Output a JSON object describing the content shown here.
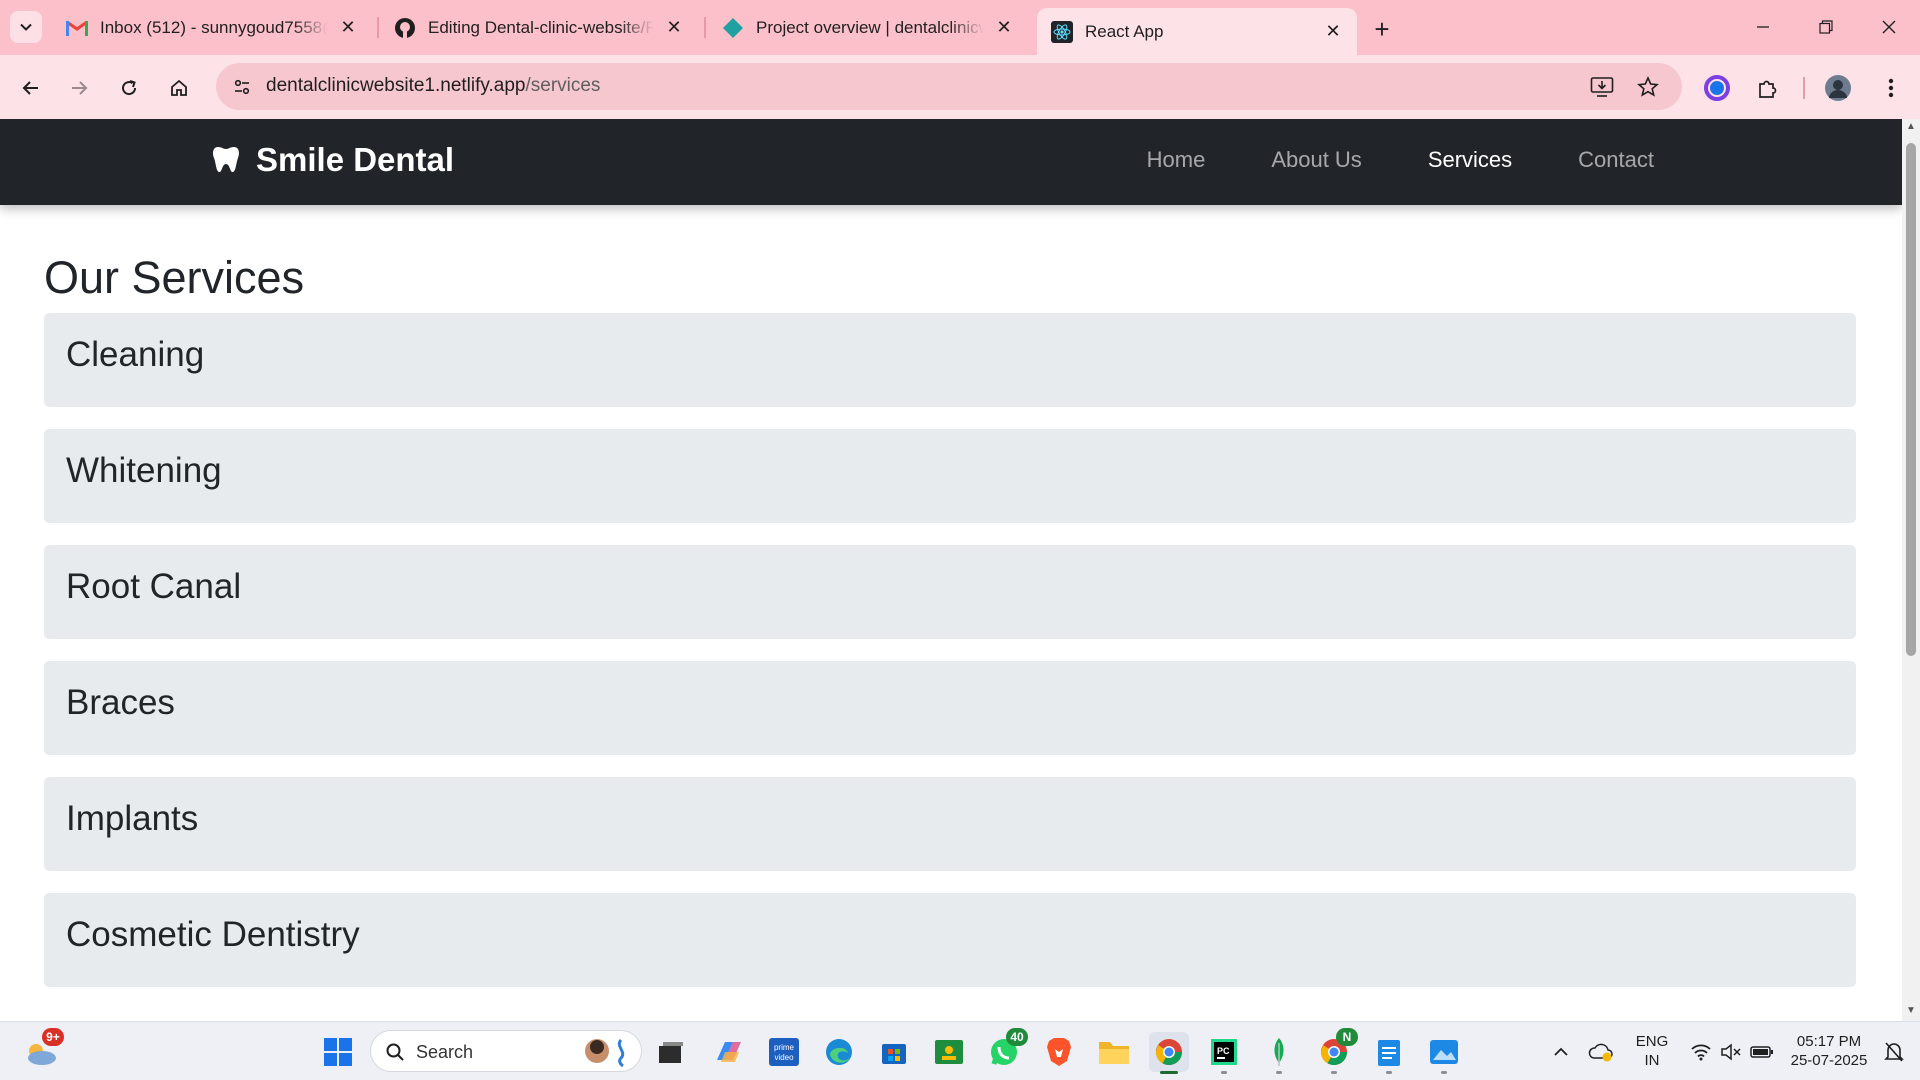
{
  "browser": {
    "tabs": [
      {
        "title": "Inbox (512) - sunnygoud7558@",
        "icon": "gmail-icon"
      },
      {
        "title": "Editing Dental-clinic-website/R",
        "icon": "github-icon"
      },
      {
        "title": "Project overview | dentalclinicw",
        "icon": "netlify-icon"
      },
      {
        "title": "React App",
        "icon": "react-icon"
      }
    ],
    "url_host": "dentalclinicwebsite1.netlify.app",
    "url_path": "/services"
  },
  "site": {
    "brand": "Smile Dental",
    "nav": [
      {
        "label": "Home",
        "active": false
      },
      {
        "label": "About Us",
        "active": false
      },
      {
        "label": "Services",
        "active": true
      },
      {
        "label": "Contact",
        "active": false
      }
    ],
    "page_title": "Our Services",
    "services": [
      "Cleaning",
      "Whitening",
      "Root Canal",
      "Braces",
      "Implants",
      "Cosmetic Dentistry"
    ]
  },
  "taskbar": {
    "search_label": "Search",
    "weather_badge": "9+",
    "whatsapp_badge": "40",
    "chrome_profile_badge": "N",
    "lang_top": "ENG",
    "lang_bottom": "IN",
    "time": "05:17 PM",
    "date": "25-07-2025"
  },
  "colors": {
    "tabstrip": "#fcc0cb",
    "toolbar": "#fde3e8",
    "site_nav": "#212529",
    "service_card": "#e8ebee"
  }
}
